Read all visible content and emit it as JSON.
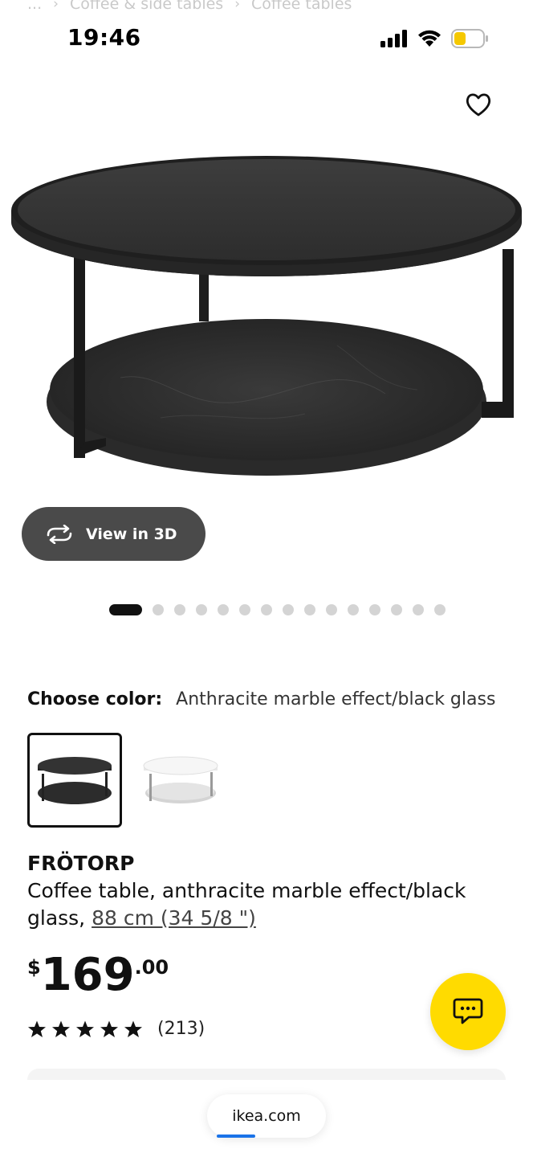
{
  "breadcrumb": {
    "items": [
      "...",
      "Coffee & side tables",
      "Coffee tables"
    ],
    "separator": "›"
  },
  "status_bar": {
    "time": "19:46",
    "battery_color": "#f5c800"
  },
  "product": {
    "view_3d_label": "View in 3D",
    "gallery": {
      "total_images": 15,
      "active_index": 0
    },
    "choose_color_label": "Choose color:",
    "selected_color": "Anthracite marble effect/black glass",
    "swatches": [
      "Anthracite marble effect/black glass",
      "White/marble effect"
    ],
    "name": "FRÖTORP",
    "description": "Coffee table, anthracite marble effect/black glass,",
    "size_link": "88 cm (34 5/8 \")",
    "price": {
      "currency": "$",
      "whole": "169",
      "cents": ".00"
    },
    "rating": {
      "stars": 5,
      "count": "(213)"
    }
  },
  "browser": {
    "url": "ikea.com"
  },
  "icons": {
    "favorite": "heart-outline-icon",
    "view3d": "rotate-3d-icon",
    "chat": "chat-bubble-icon"
  },
  "colors": {
    "accent_yellow": "#ffdb00",
    "dark_button": "#4a4a4a",
    "link_blue": "#1a73e8"
  }
}
